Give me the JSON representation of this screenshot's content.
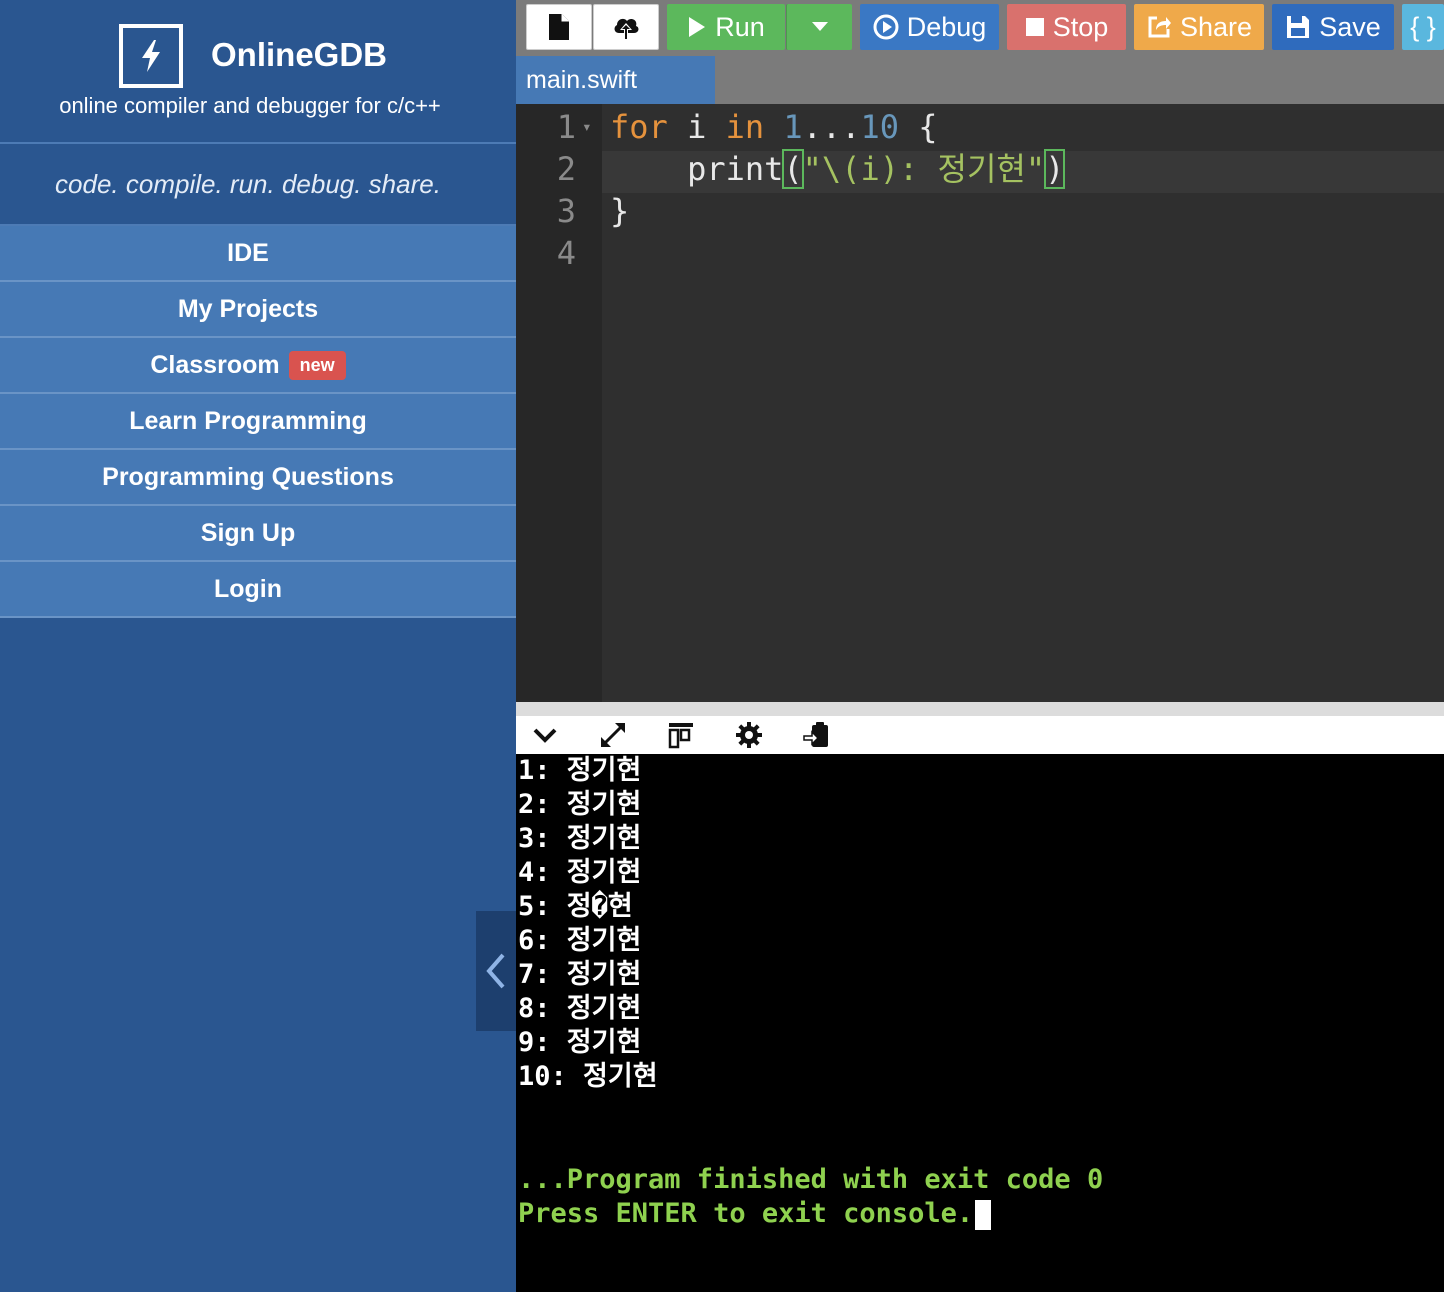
{
  "sidebar": {
    "brand_name": "OnlineGDB",
    "brand_subtitle": "online compiler and debugger for c/c++",
    "tagline": "code. compile. run. debug. share.",
    "nav": [
      {
        "label": "IDE"
      },
      {
        "label": "My Projects"
      },
      {
        "label": "Classroom",
        "badge": "new"
      },
      {
        "label": "Learn Programming"
      },
      {
        "label": "Programming Questions"
      },
      {
        "label": "Sign Up"
      },
      {
        "label": "Login"
      }
    ]
  },
  "toolbar": {
    "run_label": "Run",
    "debug_label": "Debug",
    "stop_label": "Stop",
    "share_label": "Share",
    "save_label": "Save",
    "beautify_label": "{ }"
  },
  "file_tab": {
    "name": "main.swift"
  },
  "editor": {
    "line_numbers": [
      "1",
      "2",
      "3",
      "4"
    ],
    "lines": [
      {
        "for_kw": "for",
        "var": " i ",
        "in_kw": "in",
        "range_start": " 1",
        "range_op": "...",
        "range_end": "10",
        "open": " {"
      },
      {
        "indent": "    print",
        "open_paren": "(",
        "string": "\"\\(i): 정기현\"",
        "close_paren": ")"
      },
      {
        "text": "}"
      },
      {
        "text": ""
      }
    ]
  },
  "console": {
    "output": [
      "1: 정기현",
      "2: 정기현",
      "3: 정기현",
      "4: 정기현",
      "5: 정�현",
      "6: 정기현",
      "7: 정기현",
      "8: 정기현",
      "9: 정기현",
      "10: 정기현"
    ],
    "finish_message": "...Program finished with exit code 0",
    "exit_prompt": "Press ENTER to exit console."
  },
  "colors": {
    "sidebar_bg": "#2a5690",
    "nav_bg": "#4679b5",
    "run_green": "#5cb85c",
    "debug_blue": "#3a78c4",
    "stop_red": "#d9716d",
    "share_orange": "#efa94a",
    "save_blue": "#2f6bbd",
    "console_green": "#8fd14f"
  },
  "icons": {
    "logo": "lightning-bolt-icon",
    "new_file": "file-icon",
    "upload": "cloud-upload-icon",
    "run": "play-icon",
    "debug": "circle-play-icon",
    "stop": "square-stop-icon",
    "share": "share-icon",
    "save": "floppy-disk-icon",
    "collapse_console": "chevron-down-icon",
    "expand_console": "expand-arrows-icon",
    "layout": "panel-layout-icon",
    "settings": "gear-icon",
    "copy_output": "clipboard-export-icon",
    "collapse_sidebar": "chevron-left-icon"
  }
}
